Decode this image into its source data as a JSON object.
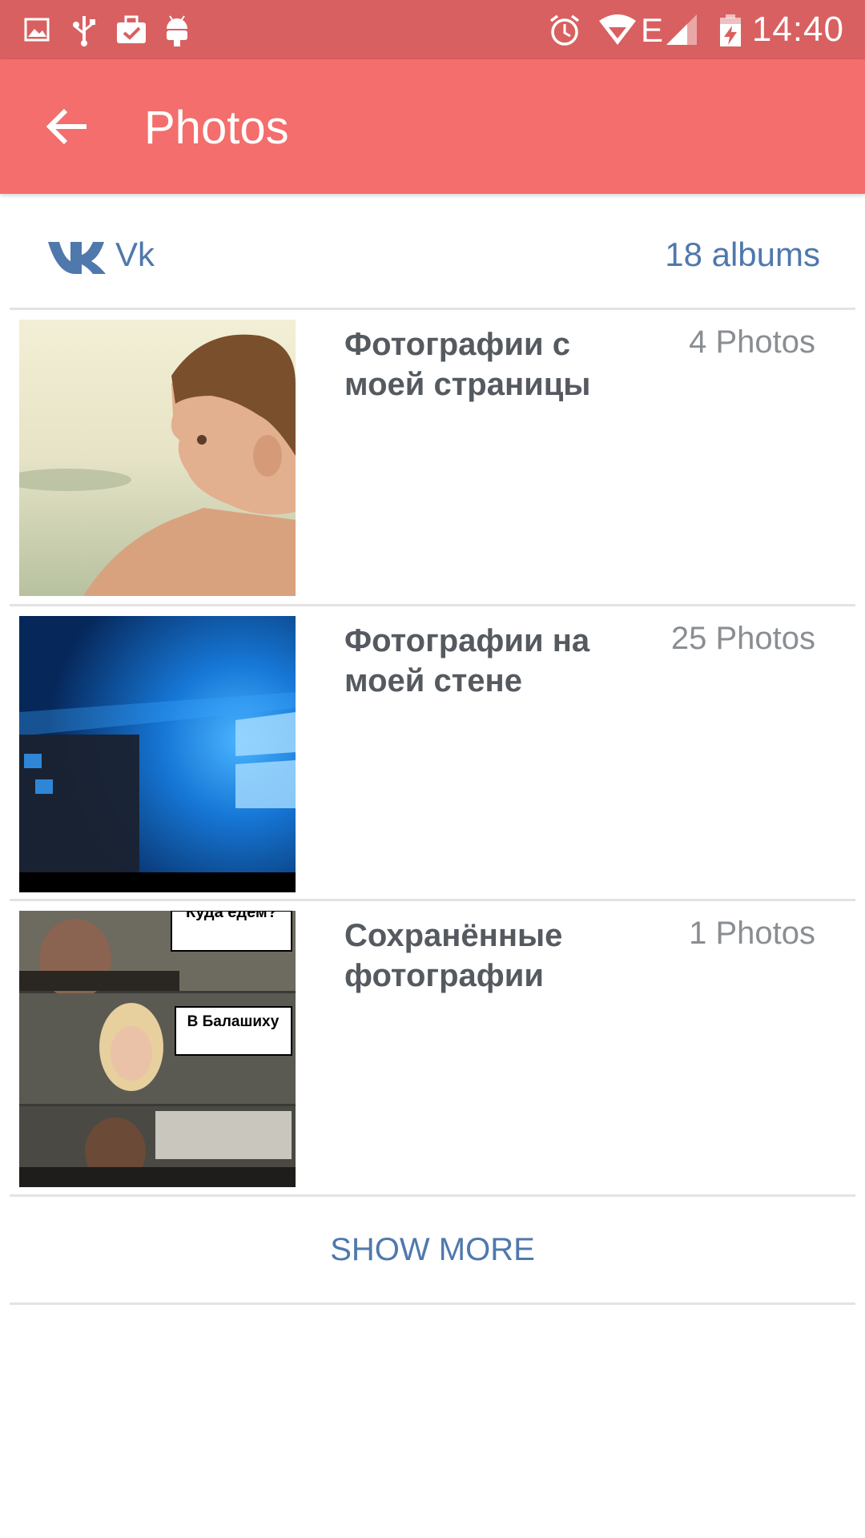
{
  "status_bar": {
    "time": "14:40",
    "icons": [
      "image-icon",
      "usb-icon",
      "briefcase-check-icon",
      "android-icon",
      "alarm-icon",
      "wifi-icon",
      "signal-icon",
      "battery-charging-icon"
    ],
    "network_label": "E"
  },
  "app_bar": {
    "title": "Photos",
    "back_icon": "arrow-back-icon"
  },
  "account": {
    "service": "Vk",
    "albums_count": "18 albums",
    "logo_icon": "vk-logo-icon",
    "color": "#4f78ad"
  },
  "albums": [
    {
      "title": "Фотографии с моей страницы",
      "count": "4 Photos",
      "thumbnail": "portrait-photo"
    },
    {
      "title": "Фотографии на моей стене",
      "count": "25 Photos",
      "thumbnail": "windows-desktop-screenshot"
    },
    {
      "title": "Сохранённые фотографии",
      "count": "1 Photos",
      "thumbnail": "comic-meme",
      "meme_text": [
        "Куда едем?",
        "В Балашиху"
      ]
    }
  ],
  "show_more": "SHOW MORE",
  "colors": {
    "status_bar": "#d96060",
    "app_bar": "#f36e6c",
    "link": "#4f78ad"
  }
}
